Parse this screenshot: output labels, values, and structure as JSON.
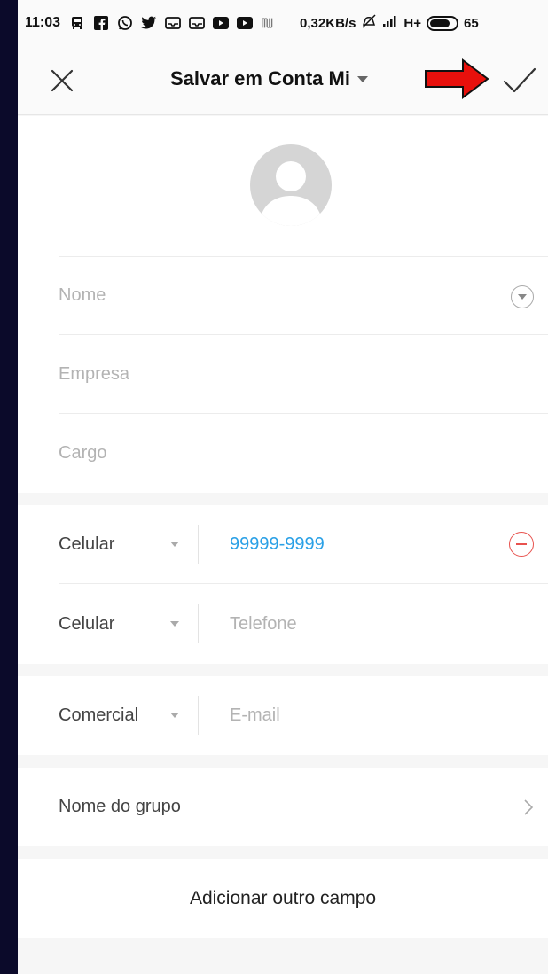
{
  "status_bar": {
    "time": "11:03",
    "icons": [
      "bus-icon",
      "facebook-icon",
      "whatsapp-icon",
      "twitter-icon",
      "mail-icon",
      "mail-icon",
      "youtube-icon",
      "youtube-icon",
      "nu-icon"
    ],
    "network_speed": "0,32KB/s",
    "network_type": "H+",
    "battery": "65"
  },
  "header": {
    "title": "Salvar em Conta Mi",
    "close_icon": "close-icon",
    "confirm_icon": "checkmark-icon",
    "annotation_color": "#e8100c"
  },
  "avatar": {
    "icon": "person-icon"
  },
  "name_section": {
    "name_placeholder": "Nome",
    "company_placeholder": "Empresa",
    "title_placeholder": "Cargo"
  },
  "phones": [
    {
      "type": "Celular",
      "value": "99999-9999",
      "placeholder": ""
    },
    {
      "type": "Celular",
      "value": "",
      "placeholder": "Telefone"
    }
  ],
  "email": {
    "type": "Comercial",
    "placeholder": "E-mail"
  },
  "group": {
    "label": "Nome do grupo"
  },
  "add_field": {
    "label": "Adicionar outro campo"
  },
  "colors": {
    "accent_blue": "#2aa0e6",
    "remove_red": "#e8524e",
    "background": "#0b0a2a"
  }
}
